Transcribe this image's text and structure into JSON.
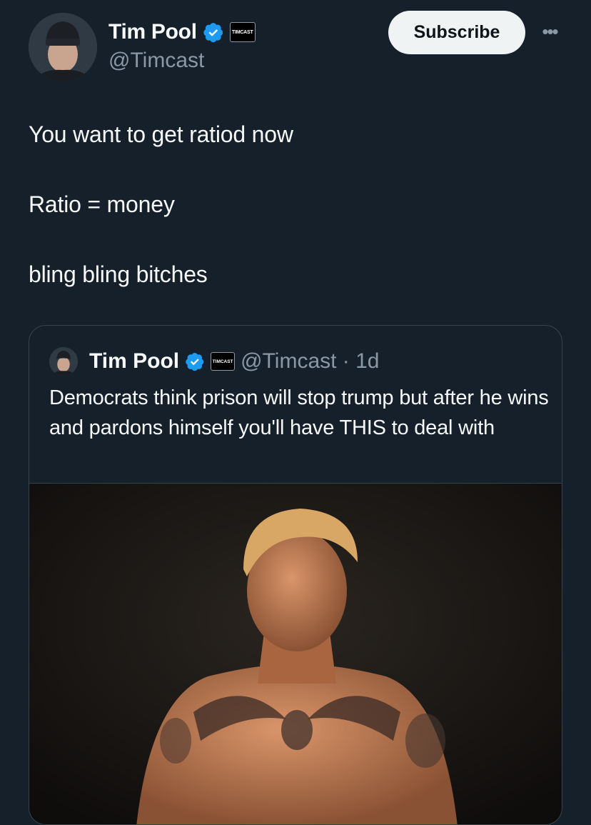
{
  "author": {
    "name": "Tim Pool",
    "handle": "@Timcast",
    "affiliate_badge": "TIMCAST",
    "verified_icon": "verified-badge-icon"
  },
  "actions": {
    "subscribe_label": "Subscribe",
    "more_label": "•••"
  },
  "tweet": {
    "lines": [
      "You want to get ratiod now",
      "Ratio = money",
      "bling bling bitches"
    ]
  },
  "quoted": {
    "name": "Tim Pool",
    "handle_time": "@Timcast · 1d",
    "affiliate_badge": "TIMCAST",
    "text": "Democrats think prison will stop trump but after he wins and pardons himself you'll have THIS to deal with"
  },
  "colors": {
    "background": "#15202b",
    "text_primary": "#f7f9f9",
    "text_secondary": "#8b98a5",
    "verified": "#1d9bf0",
    "border": "#38444d"
  }
}
